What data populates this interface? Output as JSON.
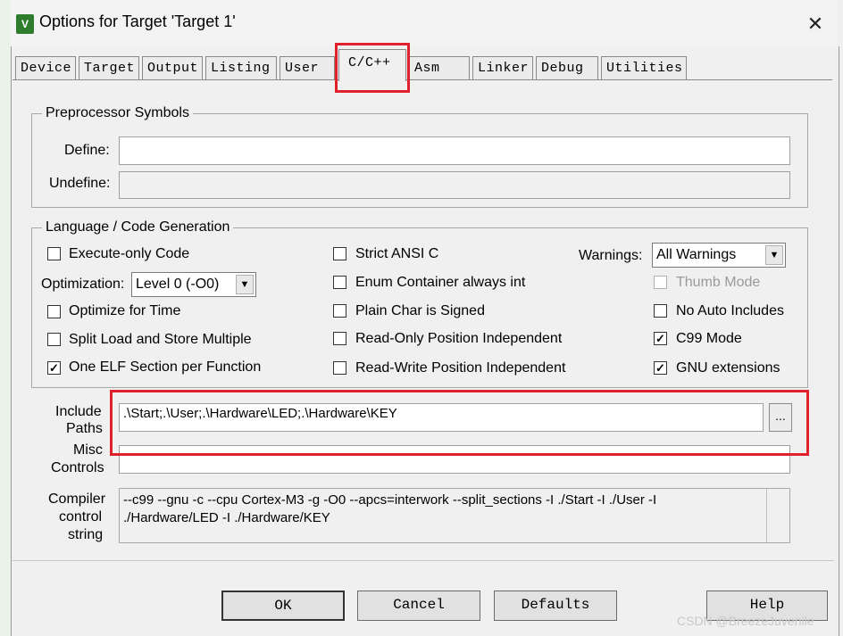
{
  "window": {
    "title": "Options for Target 'Target 1'",
    "logo_text": "V",
    "close_glyph": "✕"
  },
  "tabs": [
    {
      "label": "Device",
      "active": false
    },
    {
      "label": "Target",
      "active": false
    },
    {
      "label": "Output",
      "active": false
    },
    {
      "label": "Listing",
      "active": false
    },
    {
      "label": "User",
      "active": false
    },
    {
      "label": "C/C++",
      "active": true
    },
    {
      "label": "Asm",
      "active": false
    },
    {
      "label": "Linker",
      "active": false
    },
    {
      "label": "Debug",
      "active": false
    },
    {
      "label": "Utilities",
      "active": false
    }
  ],
  "preprocessor": {
    "title": "Preprocessor Symbols",
    "define_label": "Define:",
    "define_value": "",
    "undefine_label": "Undefine:",
    "undefine_value": ""
  },
  "language": {
    "title": "Language / Code Generation",
    "optimization_label": "Optimization:",
    "optimization_value": "Level 0 (-O0)",
    "warnings_label": "Warnings:",
    "warnings_value": "All Warnings",
    "checkboxes": {
      "execute_only": {
        "label": "Execute-only Code",
        "checked": false
      },
      "optimize_time": {
        "label": "Optimize for Time",
        "checked": false
      },
      "split_load": {
        "label": "Split Load and Store Multiple",
        "checked": false
      },
      "one_elf": {
        "label": "One ELF Section per Function",
        "checked": true
      },
      "strict_ansi": {
        "label": "Strict ANSI C",
        "checked": false
      },
      "enum_int": {
        "label": "Enum Container always int",
        "checked": false
      },
      "plain_char": {
        "label": "Plain Char is Signed",
        "checked": false
      },
      "ro_pi": {
        "label": "Read-Only Position Independent",
        "checked": false
      },
      "rw_pi": {
        "label": "Read-Write Position Independent",
        "checked": false
      },
      "thumb_mode": {
        "label": "Thumb Mode",
        "checked": false,
        "disabled": true
      },
      "no_auto_includes": {
        "label": "No Auto Includes",
        "checked": false
      },
      "c99_mode": {
        "label": "C99 Mode",
        "checked": true
      },
      "gnu_ext": {
        "label": "GNU extensions",
        "checked": true
      }
    }
  },
  "paths": {
    "include_label_1": "Include",
    "include_label_2": "Paths",
    "include_value": ".\\Start;.\\User;.\\Hardware\\LED;.\\Hardware\\KEY",
    "browse_label": "...",
    "misc_label_1": "Misc",
    "misc_label_2": "Controls",
    "misc_value": "",
    "compiler_label_1": "Compiler",
    "compiler_label_2": "control",
    "compiler_label_3": "string",
    "compiler_line_1": "--c99 --gnu -c --cpu Cortex-M3 -g -O0 --apcs=interwork --split_sections -I ./Start -I ./User -I",
    "compiler_line_2": "./Hardware/LED -I ./Hardware/KEY"
  },
  "buttons": {
    "ok": "OK",
    "cancel": "Cancel",
    "defaults": "Defaults",
    "help": "Help"
  },
  "watermark": "CSDN @BreezeJuvenile",
  "colors": {
    "highlight": "#e0202a",
    "window_bg": "#f0f0f0"
  }
}
